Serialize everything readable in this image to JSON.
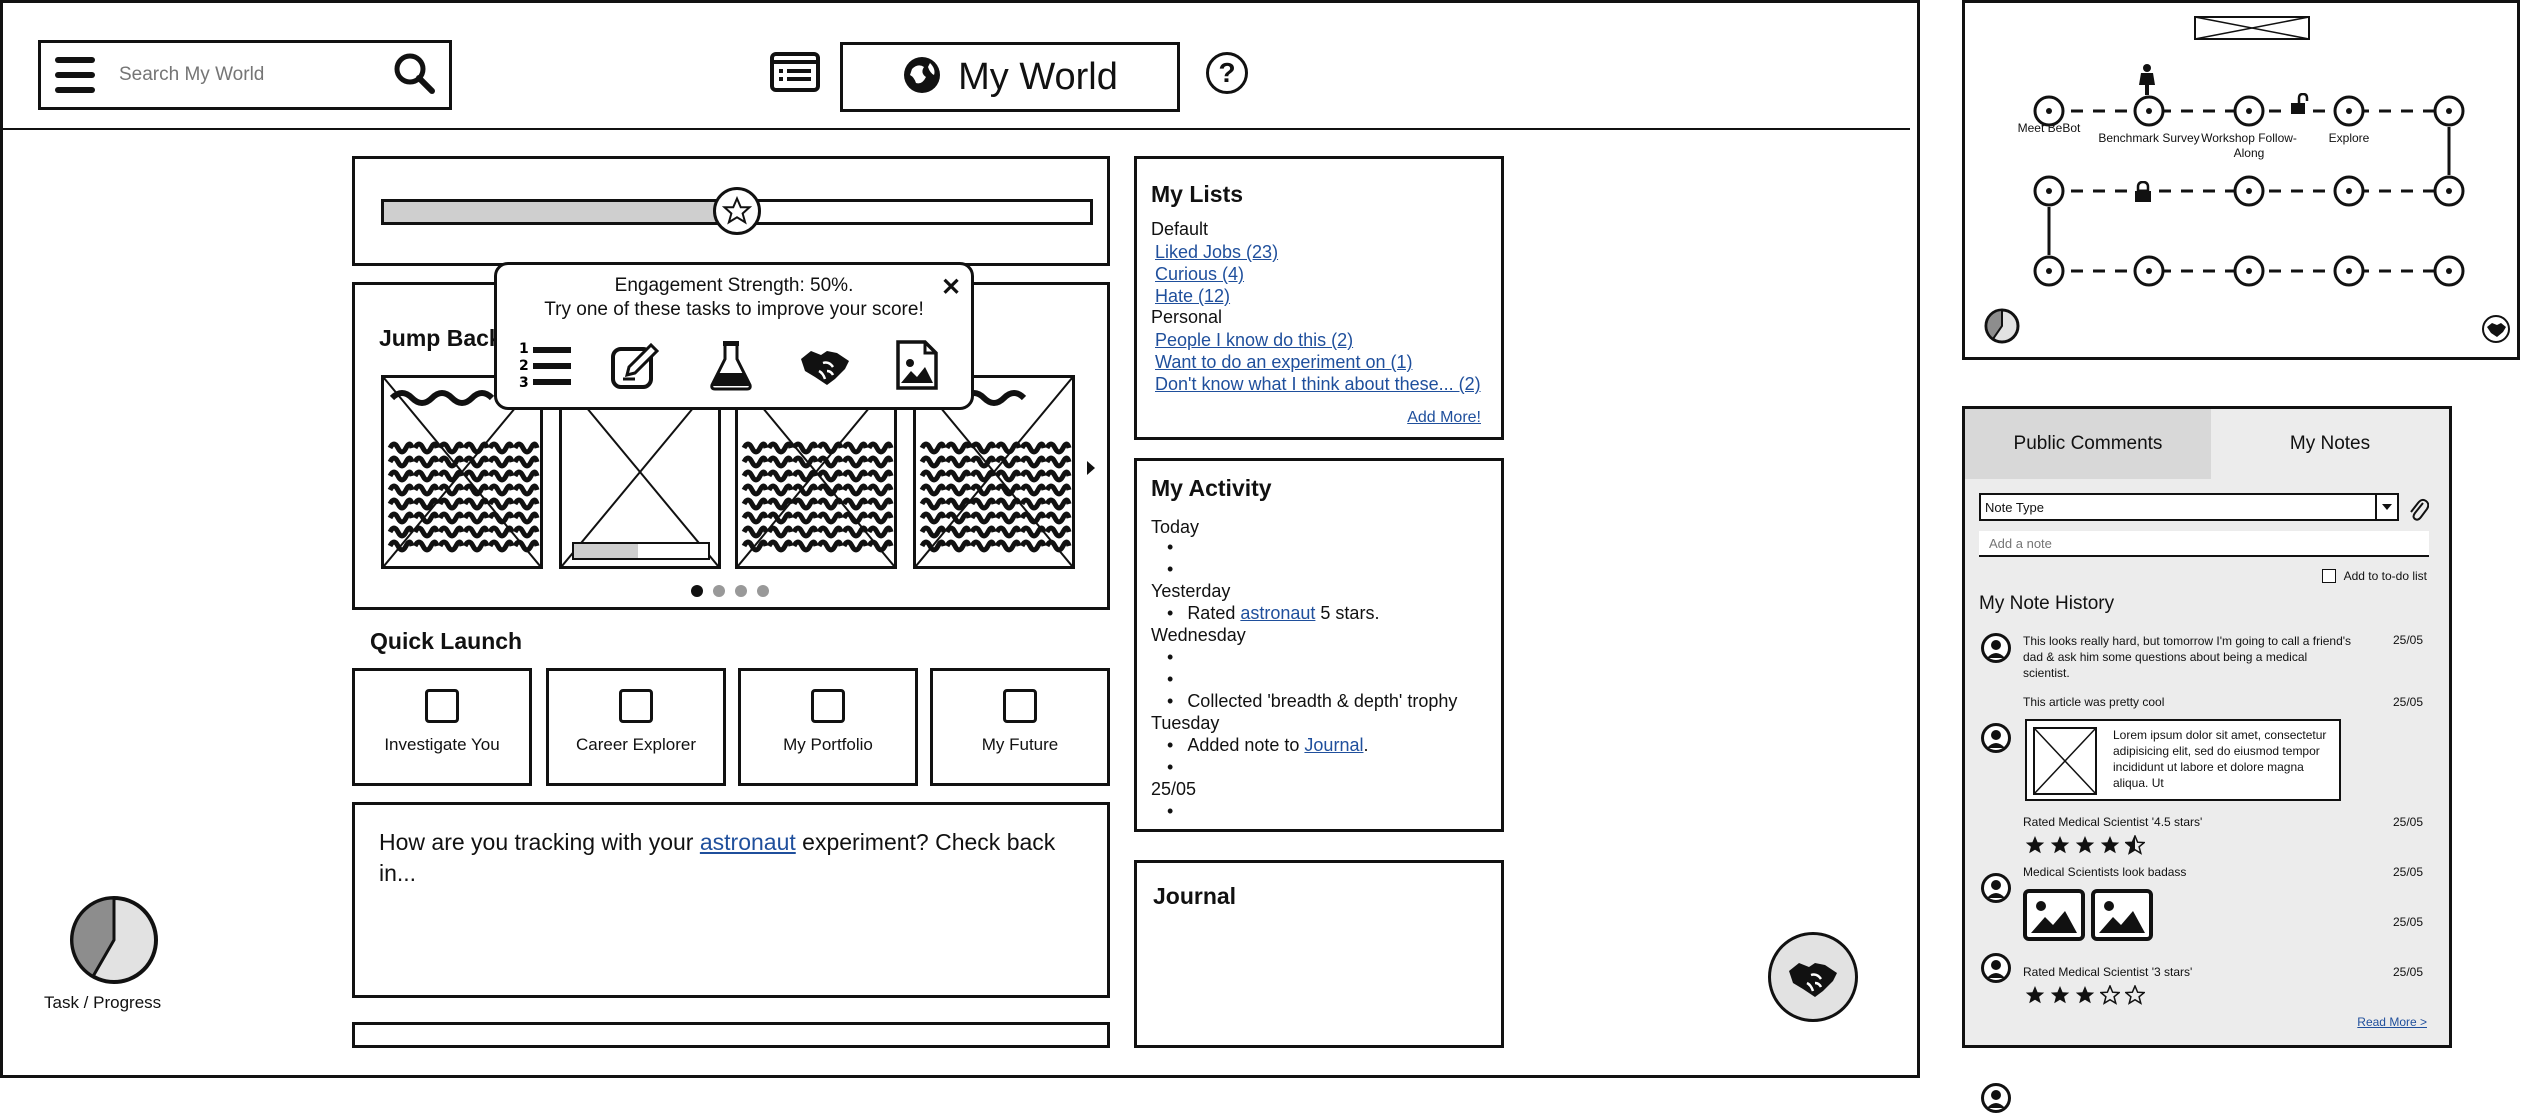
{
  "header": {
    "search_placeholder": "Search My World",
    "title": "My World"
  },
  "popup": {
    "line1": "Engagement Strength: 50%.",
    "line2": "Try one of these tasks to improve your score!",
    "icons": [
      "list-numbered-icon",
      "edit-icon",
      "flask-icon",
      "handshake-icon",
      "image-document-icon"
    ]
  },
  "engagement": {
    "progress": 0.5
  },
  "jump_back": {
    "title": "Jump Back In",
    "dots": 4,
    "active_dot": 0
  },
  "quick_launch": {
    "title": "Quick Launch",
    "items": [
      "Investigate You",
      "Career Explorer",
      "My Portfolio",
      "My Future"
    ]
  },
  "tracking": {
    "prefix": "How are you tracking with your ",
    "link": "astronaut",
    "suffix": " experiment? Check back in..."
  },
  "task_progress": {
    "label": "Task / Progress"
  },
  "lists": {
    "title": "My Lists",
    "default_label": "Default",
    "default_items": [
      "Liked Jobs (23)",
      "Curious (4)",
      "Hate (12)"
    ],
    "personal_label": "Personal",
    "personal_items": [
      "People I know do this (2)",
      "Want to do an experiment on (1)",
      "Don't know what I think about these... (2)"
    ],
    "add_more": "Add More!"
  },
  "activity": {
    "title": "My Activity",
    "today": "Today",
    "yesterday": "Yesterday",
    "rated_prefix": "Rated ",
    "rated_link": "astronaut",
    "rated_suffix": " 5 stars.",
    "wednesday": "Wednesday",
    "trophy": "Collected 'breadth & depth' trophy",
    "tuesday": "Tuesday",
    "note_prefix": "Added note to ",
    "note_link": "Journal",
    "note_suffix": ".",
    "date": "25/05"
  },
  "journal": {
    "title": "Journal"
  },
  "map": {
    "labels": [
      "Meet BeBot",
      "Benchmark Survey",
      "Workshop Follow-Along",
      "Explore"
    ]
  },
  "notes_panel": {
    "tab_public": "Public Comments",
    "tab_notes": "My Notes",
    "note_type": "Note Type",
    "add_note_placeholder": "Add a note",
    "todo_label": "Add to to-do list",
    "history_title": "My Note History",
    "entries": [
      {
        "text": "This looks really hard, but tomorrow I'm going to call a friend's dad & ask him some questions about being a medical scientist.",
        "date": "25/05"
      },
      {
        "text": "This article was pretty cool",
        "date": "25/05",
        "card_text": "Lorem ipsum dolor sit amet, consectetur adipisicing elit, sed do eiusmod tempor incididunt ut labore et dolore magna aliqua. Ut"
      },
      {
        "text": "Rated Medical Scientist '4.5 stars'",
        "date": "25/05",
        "stars": 4.5
      },
      {
        "text": "Medical Scientists look badass",
        "date": "25/05",
        "images_date": "25/05"
      },
      {
        "text": "Rated Medical Scientist '3 stars'",
        "date": "25/05",
        "stars": 3
      }
    ],
    "read_more": "Read More >"
  }
}
